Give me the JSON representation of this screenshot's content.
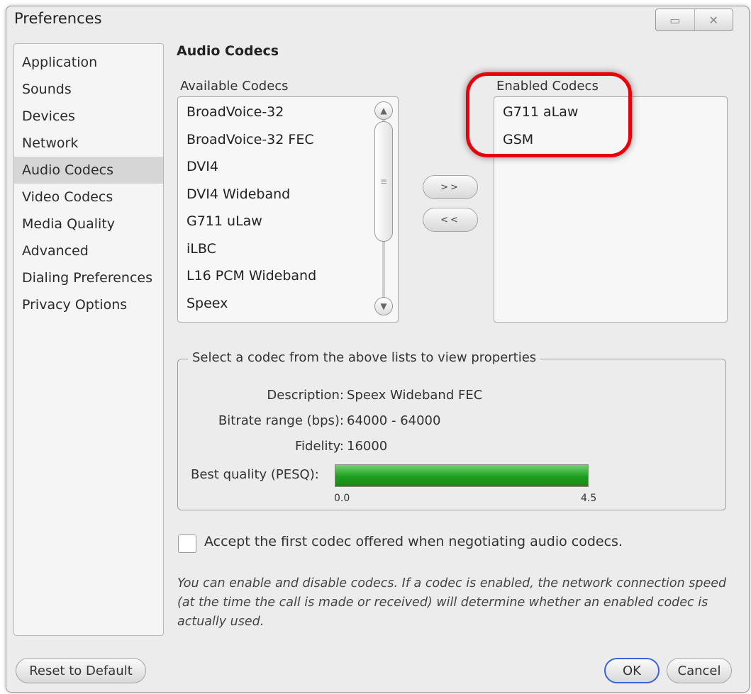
{
  "window": {
    "title": "Preferences",
    "minimize_glyph": "▭",
    "close_glyph": "✕"
  },
  "sidebar": {
    "items": [
      {
        "label": "Application"
      },
      {
        "label": "Sounds"
      },
      {
        "label": "Devices"
      },
      {
        "label": "Network"
      },
      {
        "label": "Audio Codecs",
        "selected": true
      },
      {
        "label": "Video Codecs"
      },
      {
        "label": "Media Quality"
      },
      {
        "label": "Advanced"
      },
      {
        "label": "Dialing Preferences"
      },
      {
        "label": "Privacy Options"
      }
    ]
  },
  "main": {
    "section_title": "Audio Codecs",
    "available": {
      "label": "Available Codecs",
      "items": [
        "BroadVoice-32",
        "BroadVoice-32 FEC",
        "DVI4",
        "DVI4 Wideband",
        "G711 uLaw",
        "iLBC",
        "L16 PCM Wideband",
        "Speex"
      ]
    },
    "enabled": {
      "label": "Enabled Codecs",
      "items": [
        "G711 aLaw",
        "GSM"
      ]
    },
    "add_button": ">>",
    "remove_button": "<<",
    "properties": {
      "legend": "Select a codec from the above lists to view properties",
      "description_label": "Description:",
      "description_value": "Speex Wideband FEC",
      "bitrate_label": "Bitrate range (bps):",
      "bitrate_value": "64000 - 64000",
      "fidelity_label": "Fidelity:",
      "fidelity_value": "16000",
      "quality_label": "Best quality (PESQ):",
      "quality_fraction": 1.0,
      "quality_min": "0.0",
      "quality_max": "4.5"
    },
    "accept_first": {
      "label": "Accept the first codec offered when negotiating audio codecs.",
      "checked": false
    },
    "note": "You can enable and disable codecs. If a codec is enabled, the network connection speed (at the time the call is made or received) will determine whether an enabled codec is actually used."
  },
  "footer": {
    "reset_label": "Reset to Default",
    "ok_label": "OK",
    "cancel_label": "Cancel"
  },
  "colors": {
    "highlight_ring": "#e8000b",
    "quality_bar": "#1e9e1e",
    "default_button_border": "#3a64d8"
  }
}
